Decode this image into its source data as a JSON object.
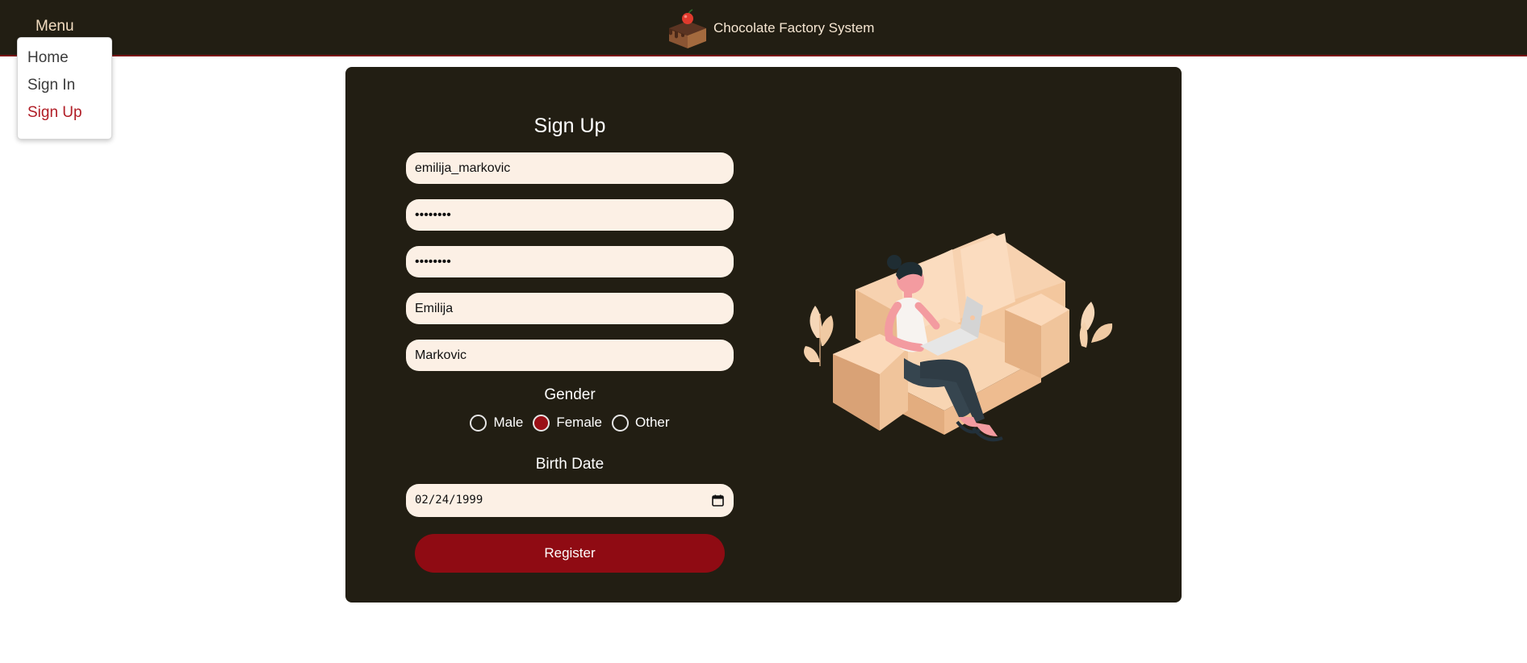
{
  "header": {
    "menu_label": "Menu",
    "app_title": "Chocolate Factory System",
    "logo_icon": "cake-logo-icon"
  },
  "menu": {
    "items": [
      {
        "label": "Home",
        "active": false
      },
      {
        "label": "Sign In",
        "active": false
      },
      {
        "label": "Sign Up",
        "active": true
      }
    ]
  },
  "form": {
    "title": "Sign Up",
    "username": "emilija_markovic",
    "password_masked": "••••••••",
    "confirm_password_masked": "••••••••",
    "first_name": "Emilija",
    "last_name": "Markovic",
    "gender_label": "Gender",
    "gender_options": [
      {
        "label": "Male",
        "selected": false
      },
      {
        "label": "Female",
        "selected": true
      },
      {
        "label": "Other",
        "selected": false
      }
    ],
    "birth_date_label": "Birth Date",
    "birth_date": "02/24/1999",
    "register_label": "Register"
  },
  "colors": {
    "header_bg": "#221e13",
    "card_bg": "#221e13",
    "accent": "#8f0b13",
    "active_link": "#b01c25",
    "field_bg": "#fcf0e5"
  }
}
